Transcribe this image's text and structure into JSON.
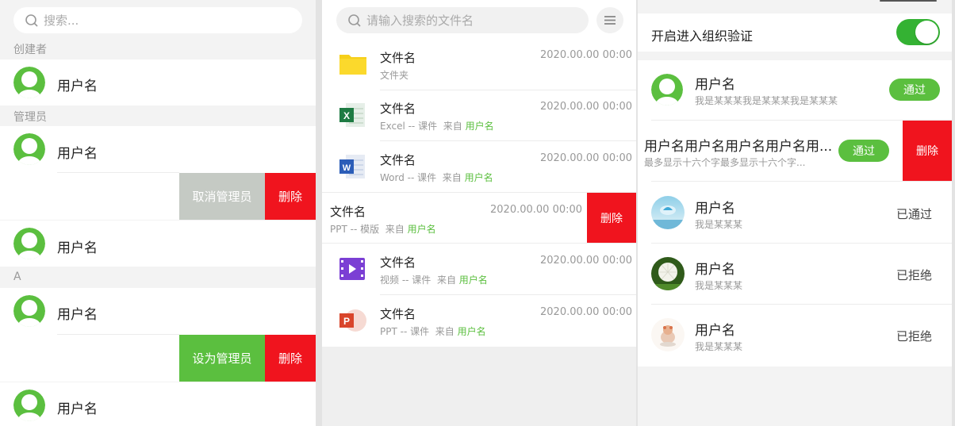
{
  "left": {
    "search_placeholder": "搜索...",
    "section_creator": "创建者",
    "section_admin": "管理员",
    "section_a": "A",
    "user1": "用户名",
    "user2": "用户名",
    "user3": "用户名",
    "user4": "用户名",
    "user5": "用户名",
    "cancel_admin": "取消管理员",
    "delete1": "删除",
    "set_admin": "设为管理员",
    "delete2": "删除"
  },
  "middle": {
    "search_placeholder": "请输入搜索的文件名",
    "files": [
      {
        "name": "文件名",
        "type": "文件夹",
        "src_label": "",
        "src_user": "",
        "date": "2020.00.00 00:00",
        "icon": "folder-icon"
      },
      {
        "name": "文件名",
        "type": "Excel -- 课件",
        "src_label": "来自",
        "src_user": "用户名",
        "date": "2020.00.00 00:00",
        "icon": "excel-icon"
      },
      {
        "name": "文件名",
        "type": "Word -- 课件",
        "src_label": "来自",
        "src_user": "用户名",
        "date": "2020.00.00 00:00",
        "icon": "word-icon"
      },
      {
        "name": "文件名",
        "type": "PPT -- 模版",
        "src_label": "来自",
        "src_user": "用户名",
        "date": "2020.00.00 00:00",
        "icon": "none"
      },
      {
        "name": "文件名",
        "type": "视频 -- 课件",
        "src_label": "来自",
        "src_user": "用户名",
        "date": "2020.00.00 00:00",
        "icon": "video-icon"
      },
      {
        "name": "文件名",
        "type": "PPT -- 课件",
        "src_label": "来自",
        "src_user": "用户名",
        "date": "2020.00.00 00:00",
        "icon": "ppt-icon"
      }
    ],
    "delete": "删除"
  },
  "right": {
    "toggle_label": "开启进入组织验证",
    "toggle_on": true,
    "rows": [
      {
        "name": "用户名",
        "sub": "我是某某某我是某某某我是某某某",
        "action": "通过"
      },
      {
        "name": "用户名用户名用户名用户名用...",
        "sub": "最多显示十六个字最多显示十六个字...",
        "action": "通过",
        "delete": "删除"
      },
      {
        "name": "用户名",
        "sub": "我是某某某",
        "status": "已通过"
      },
      {
        "name": "用户名",
        "sub": "我是某某某",
        "status": "已拒绝"
      },
      {
        "name": "用户名",
        "sub": "我是某某某",
        "status": "已拒绝"
      }
    ]
  },
  "colors": {
    "green": "#5bbf3f",
    "red": "#f0141e",
    "gray_btn": "#c5cac4",
    "toggle": "#34b233"
  }
}
